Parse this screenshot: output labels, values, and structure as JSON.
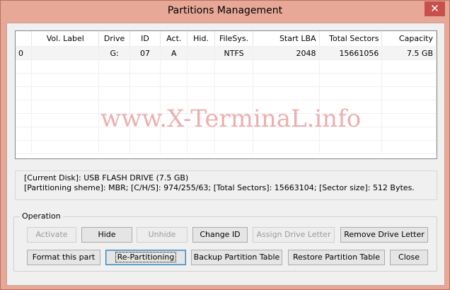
{
  "window": {
    "title": "Partitions Management",
    "close_glyph": "✕"
  },
  "table": {
    "columns": [
      "",
      "Vol. Label",
      "Drive",
      "ID",
      "Act.",
      "Hid.",
      "FileSys.",
      "Start LBA",
      "Total Sectors",
      "Capacity"
    ],
    "rows": [
      [
        "0",
        "",
        "G:",
        "07",
        "A",
        "",
        "NTFS",
        "2048",
        "15661056",
        "7.5 GB"
      ]
    ]
  },
  "watermark": "www.X-TerminaL.info",
  "disk_info": {
    "line1": "[Current Disk]:   USB FLASH DRIVE (7.5 GB)",
    "line2": "[Partitioning sheme]: MBR;  [C/H/S]: 974/255/63; [Total Sectors]: 15663104; [Sector size]: 512 Bytes."
  },
  "operation": {
    "label": "Operation",
    "buttons": {
      "activate": "Activate",
      "hide": "Hide",
      "unhide": "Unhide",
      "change_id": "Change ID",
      "assign_letter": "Assign Drive Letter",
      "remove_letter": "Remove Drive Letter",
      "format": "Format this part",
      "repartition": "Re-Partitioning",
      "backup": "Backup Partition Table",
      "restore": "Restore Partition Table",
      "close": "Close"
    }
  }
}
